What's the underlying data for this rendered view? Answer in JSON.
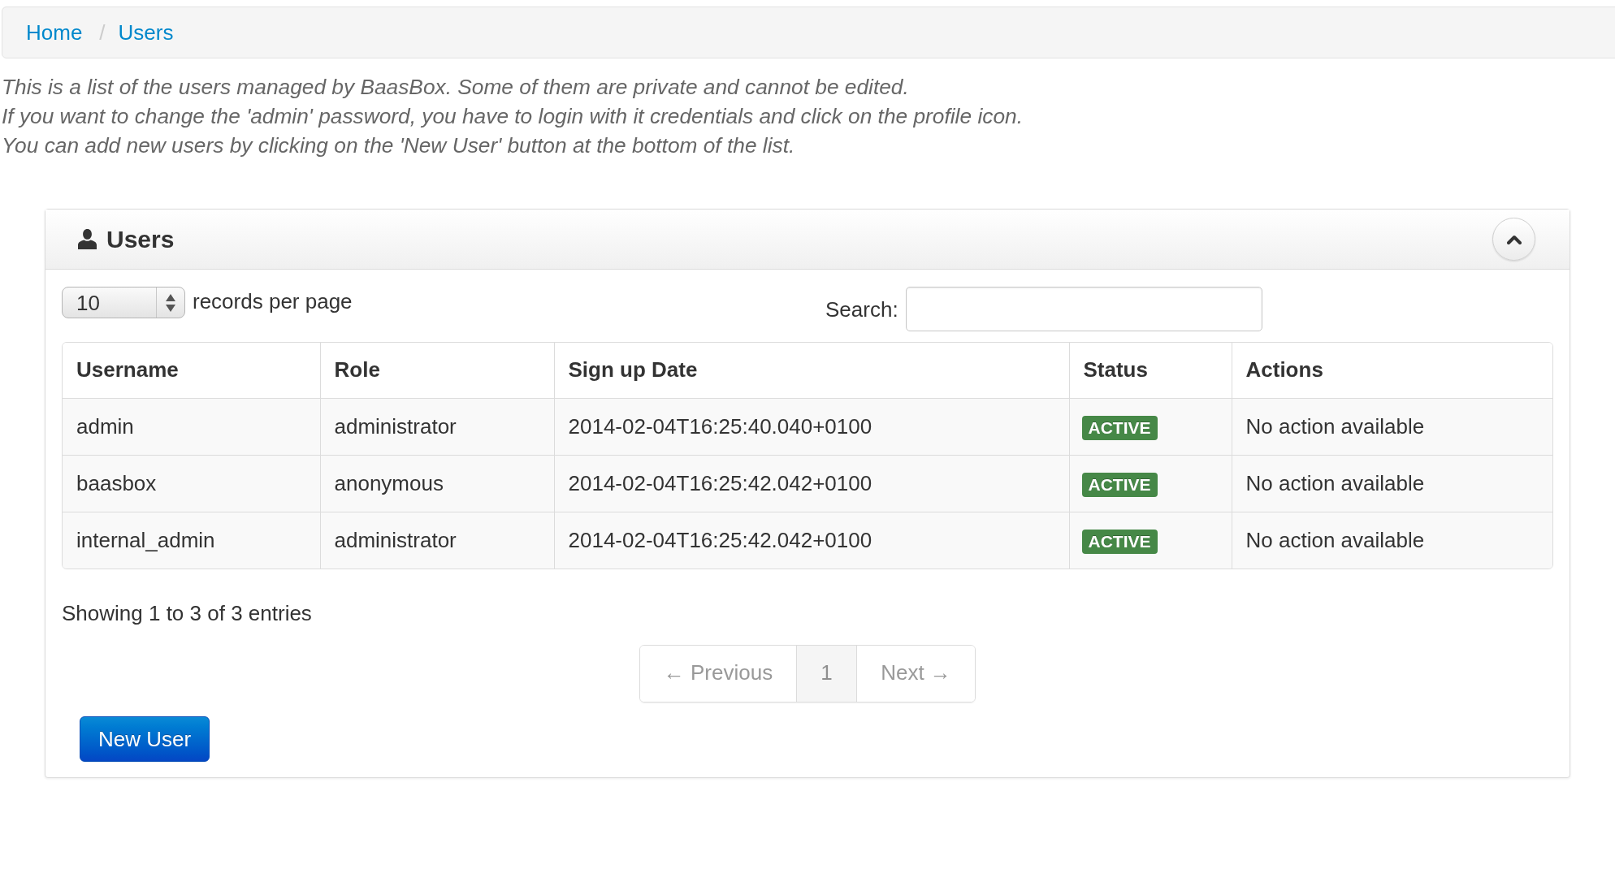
{
  "breadcrumb": {
    "items": [
      {
        "label": "Home"
      },
      {
        "label": "Users"
      }
    ],
    "separator": "/"
  },
  "description": [
    "This is a list of the users managed by BaasBox. Some of them are private and cannot be edited.",
    "If you want to change the 'admin' password, you have to login with it credentials and click on the profile icon.",
    "You can add new users by clicking on the 'New User' button at the bottom of the list."
  ],
  "panel": {
    "title": "Users",
    "expanded": true,
    "length_menu": {
      "value": "10",
      "label": "records per page"
    },
    "search": {
      "label": "Search:"
    },
    "table": {
      "columns": [
        "Username",
        "Role",
        "Sign up Date",
        "Status",
        "Actions"
      ],
      "rows": [
        {
          "username": "admin",
          "role": "administrator",
          "sign_up_date": "2014-02-04T16:25:40.040+0100",
          "status": "ACTIVE",
          "actions": "No action available"
        },
        {
          "username": "baasbox",
          "role": "anonymous",
          "sign_up_date": "2014-02-04T16:25:42.042+0100",
          "status": "ACTIVE",
          "actions": "No action available"
        },
        {
          "username": "internal_admin",
          "role": "administrator",
          "sign_up_date": "2014-02-04T16:25:42.042+0100",
          "status": "ACTIVE",
          "actions": "No action available"
        }
      ]
    },
    "info": "Showing 1 to 3 of 3 entries",
    "pagination": [
      {
        "label": "← Previous",
        "selected": false,
        "disabled": true
      },
      {
        "label": "1",
        "selected": true,
        "disabled": false
      },
      {
        "label": "Next →",
        "selected": false,
        "disabled": true
      }
    ],
    "new_user_button": "New User"
  }
}
